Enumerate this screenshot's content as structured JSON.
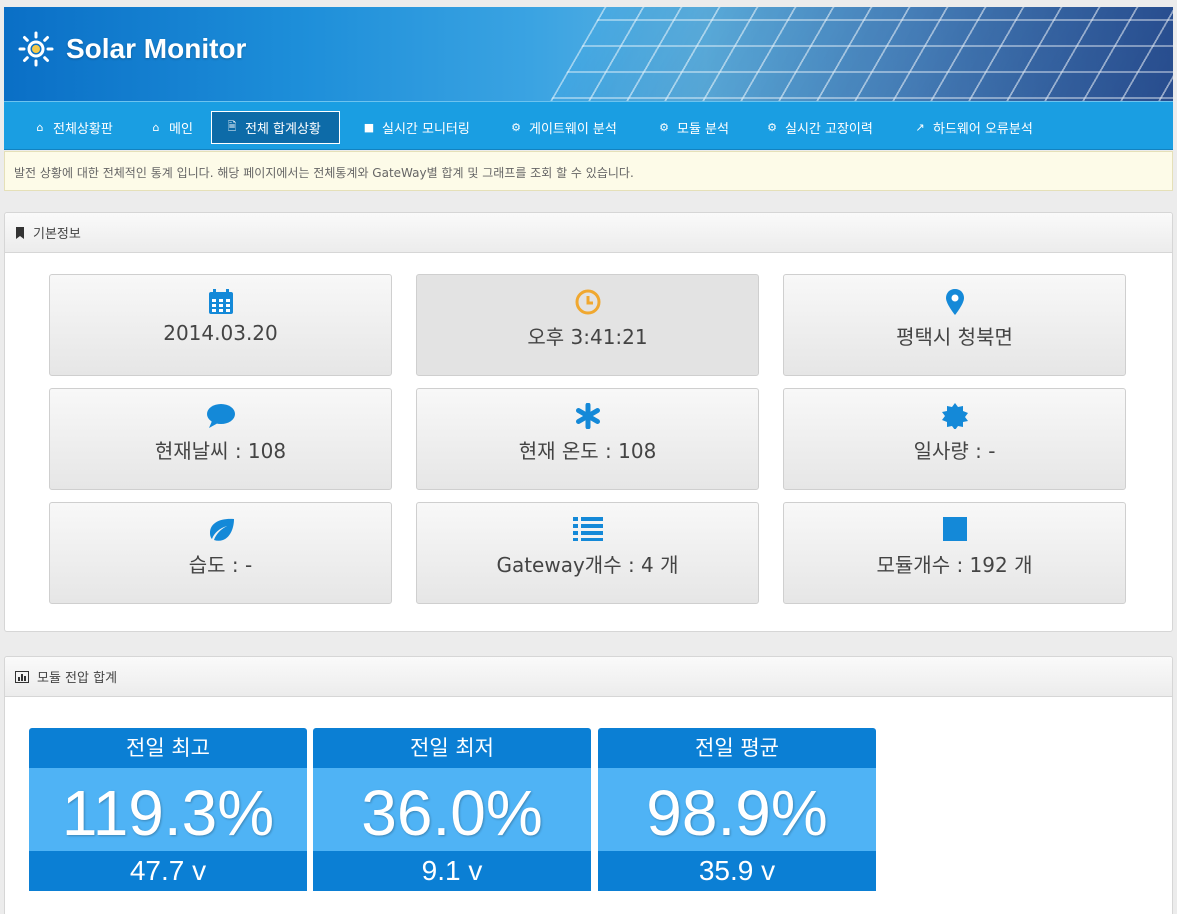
{
  "app": {
    "title": "Solar Monitor"
  },
  "nav": {
    "items": [
      {
        "label": "전체상황판",
        "icon": "home-icon"
      },
      {
        "label": "메인",
        "icon": "home-icon"
      },
      {
        "label": "전체 합계상황",
        "icon": "document-icon",
        "active": true
      },
      {
        "label": "실시간 모니터링",
        "icon": "video-camera-icon"
      },
      {
        "label": "게이트웨이 분석",
        "icon": "cogs-icon"
      },
      {
        "label": "모듈 분석",
        "icon": "cogs-icon"
      },
      {
        "label": "실시간 고장이력",
        "icon": "cogs-icon"
      },
      {
        "label": "하드웨어 오류분석",
        "icon": "external-link-icon"
      }
    ]
  },
  "notice": "발전 상황에 대한 전체적인 통계 입니다. 해당 페이지에서는 전체통계와 GateWay별 합계 및 그래프를 조회 할 수 있습니다.",
  "basic_info": {
    "title": "기본정보",
    "tiles": [
      {
        "text": "2014.03.20",
        "icon": "calendar-icon"
      },
      {
        "text": "오후 3:41:21",
        "icon": "clock-icon"
      },
      {
        "text": "평택시 청북면",
        "icon": "map-marker-icon"
      },
      {
        "text": "현재날씨 : 108",
        "icon": "speech-bubble-icon"
      },
      {
        "text": "현재 온도 : 108",
        "icon": "asterisk-icon"
      },
      {
        "text": "일사량 : -",
        "icon": "sun-badge-icon"
      },
      {
        "text": "습도 : -",
        "icon": "leaf-icon"
      },
      {
        "text": "Gateway개수 : 4 개",
        "icon": "list-icon"
      },
      {
        "text": "모듈개수 : 192 개",
        "icon": "square-icon"
      }
    ]
  },
  "voltage": {
    "title": "모듈 전압 합계",
    "stats": [
      {
        "label": "전일 최고",
        "percent": "119.3%",
        "volt": "47.7 v"
      },
      {
        "label": "전일 최저",
        "percent": "36.0%",
        "volt": "9.1 v"
      },
      {
        "label": "전일 평균",
        "percent": "98.9%",
        "volt": "35.9 v"
      }
    ]
  },
  "colors": {
    "accent": "#1a9ee2",
    "stat_dark": "#0b7fd4",
    "stat_light": "#4fb3f5",
    "icon_blue": "#1489d8",
    "clock_orange": "#f0a830"
  }
}
